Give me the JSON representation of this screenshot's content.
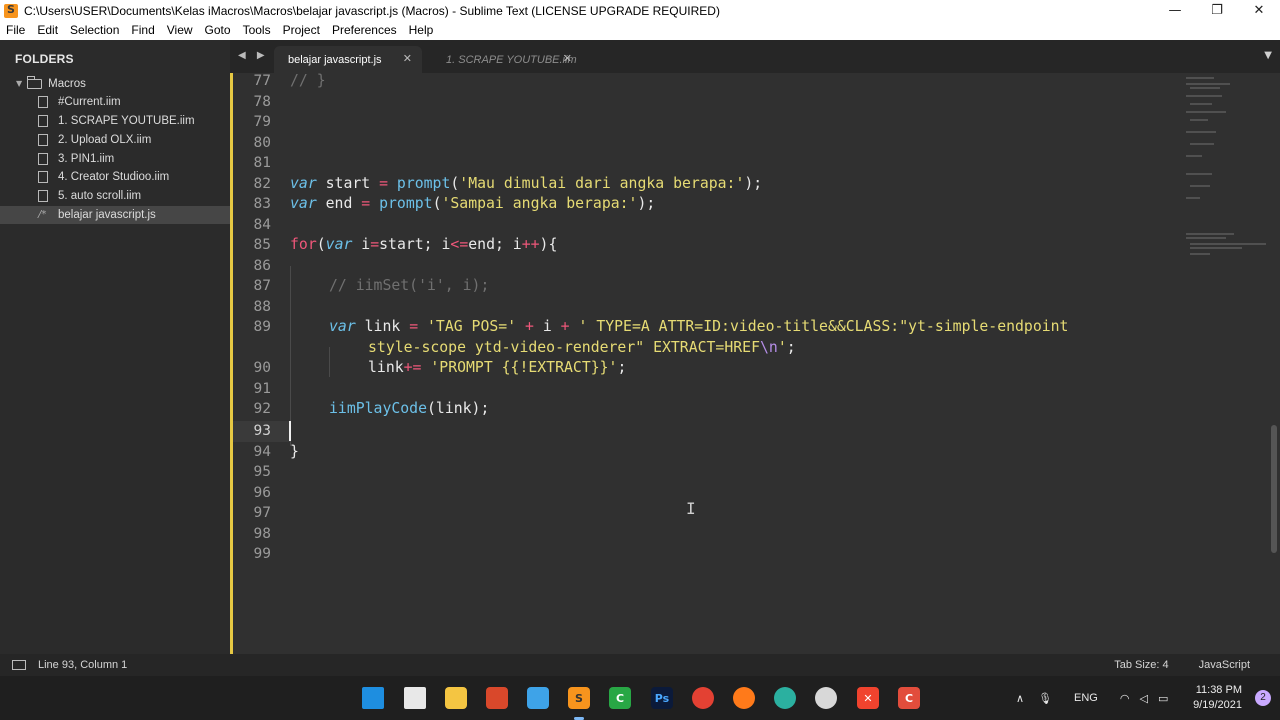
{
  "window": {
    "title": "C:\\Users\\USER\\Documents\\Kelas iMacros\\Macros\\belajar javascript.js (Macros) - Sublime Text (LICENSE UPGRADE REQUIRED)",
    "minimize_glyph": "—",
    "maximize_glyph": "❐",
    "close_glyph": "✕"
  },
  "menu": [
    "File",
    "Edit",
    "Selection",
    "Find",
    "View",
    "Goto",
    "Tools",
    "Project",
    "Preferences",
    "Help"
  ],
  "sidebar": {
    "header": "FOLDERS",
    "folder": "Macros",
    "files": [
      "#Current.iim",
      "1. SCRAPE YOUTUBE.iim",
      "2. Upload OLX.iim",
      "3. PIN1.iim",
      "4. Creator Studioo.iim",
      "5. auto scroll.iim",
      "belajar javascript.js"
    ],
    "active_file": "belajar javascript.js"
  },
  "tabs": [
    {
      "label": "belajar javascript.js",
      "active": true
    },
    {
      "label": "1. SCRAPE YOUTUBE.iim",
      "active": false
    }
  ],
  "editor": {
    "line_numbers": [
      "77",
      "78",
      "79",
      "80",
      "81",
      "82",
      "83",
      "84",
      "85",
      "86",
      "87",
      "88",
      "89",
      "",
      "90",
      "91",
      "92",
      "93",
      "94",
      "95",
      "96",
      "97",
      "98",
      "99"
    ],
    "current_line": "93",
    "code": {
      "l77": "// }",
      "l82_kw": "var",
      "l82_id": " start ",
      "l82_op": "=",
      "l82_fn": " prompt",
      "l82_p1": "(",
      "l82_str": "'Mau dimulai dari angka berapa:'",
      "l82_p2": ");",
      "l83_kw": "var",
      "l83_id": " end ",
      "l83_op": "=",
      "l83_fn": " prompt",
      "l83_p1": "(",
      "l83_str": "'Sampai angka berapa:'",
      "l83_p2": ");",
      "l85_ctrl": "for",
      "l85_p1": "(",
      "l85_kw": "var",
      "l85_a": " i",
      "l85_op1": "=",
      "l85_b": "start; i",
      "l85_op2": "<=",
      "l85_c": "end; i",
      "l85_op3": "++",
      "l85_d": "){",
      "l87": "// iimSet('i', i);",
      "l89_kw": "var",
      "l89_a": " link ",
      "l89_op1": "=",
      "l89_str1": " 'TAG POS='",
      "l89_op2": " +",
      "l89_b": " i ",
      "l89_op3": "+",
      "l89_str2": " ' TYPE=A ATTR=ID:video-title&&CLASS:\"yt-simple-endpoint",
      "l89w_str": "style-scope ytd-video-renderer\" EXTRACT=HREF",
      "l89w_esc": "\\n",
      "l89w_str2": "'",
      "l89w_end": ";",
      "l90_a": "link",
      "l90_op": "+=",
      "l90_str": " 'PROMPT {{!EXTRACT}}'",
      "l90_end": ";",
      "l92_fn": "iimPlayCode",
      "l92_rest": "(link);",
      "l94": "}"
    }
  },
  "status": {
    "position": "Line 93, Column 1",
    "tab_size": "Tab Size: 4",
    "syntax": "JavaScript"
  },
  "taskbar": {
    "icons": [
      "windows-start",
      "task-view",
      "file-explorer",
      "app-red",
      "notepad",
      "sublime-text",
      "camtasia",
      "photoshop",
      "chrome",
      "firefox",
      "edge",
      "app-circle",
      "xampp",
      "app-red-2"
    ],
    "tray_lang": "ENG",
    "time": "11:38 PM",
    "date": "9/19/2021",
    "notifications": "2"
  }
}
